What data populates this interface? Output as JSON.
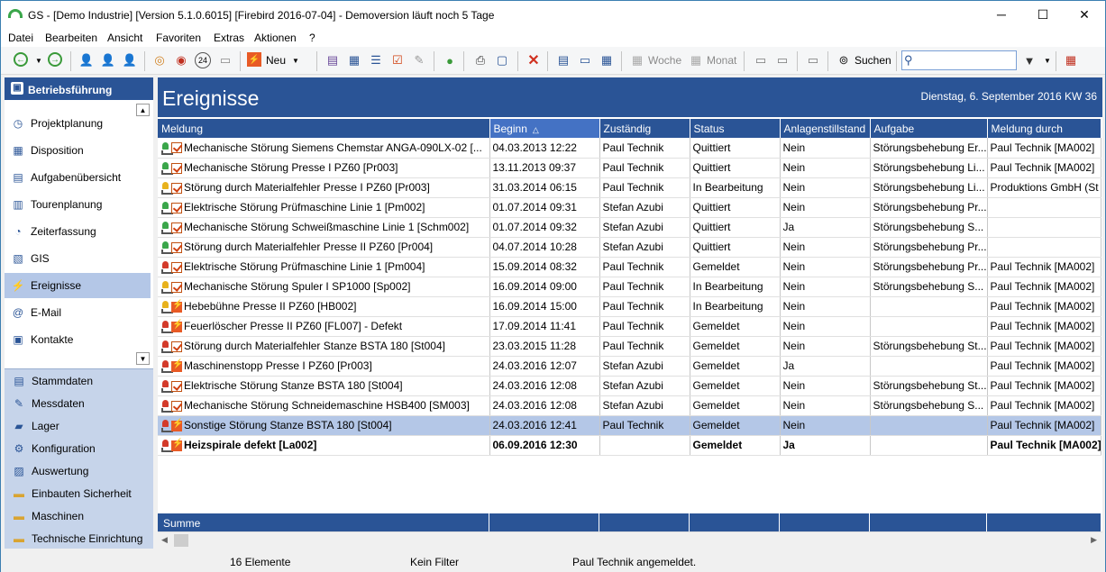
{
  "window": {
    "title": "GS - [Demo Industrie]  [Version  5.1.0.6015]  [Firebird 2016-07-04] - Demoversion läuft noch 5 Tage",
    "min": "─",
    "max": "☐",
    "close": "✕"
  },
  "menu": [
    "Datei",
    "Bearbeiten",
    "Ansicht",
    "Favoriten",
    "Extras",
    "Aktionen",
    "?"
  ],
  "toolbar": {
    "neu": "Neu",
    "woche": "Woche",
    "monat": "Monat",
    "suchen": "Suchen",
    "search_value": ""
  },
  "sidebar": {
    "header": "Betriebsführung",
    "items": [
      {
        "label": "Projektplanung",
        "icon": "project-icon",
        "glyph": "◷"
      },
      {
        "label": "Disposition",
        "icon": "calendar-icon",
        "glyph": "▦"
      },
      {
        "label": "Aufgabenübersicht",
        "icon": "tasks-icon",
        "glyph": "▤"
      },
      {
        "label": "Tourenplanung",
        "icon": "route-icon",
        "glyph": "▥"
      },
      {
        "label": "Zeiterfassung",
        "icon": "clock-icon",
        "glyph": "◔"
      },
      {
        "label": "GIS",
        "icon": "map-icon",
        "glyph": "▧"
      },
      {
        "label": "Ereignisse",
        "icon": "event-icon",
        "glyph": "⚡"
      },
      {
        "label": "E-Mail",
        "icon": "email-icon",
        "glyph": "@"
      },
      {
        "label": "Kontakte",
        "icon": "contacts-icon",
        "glyph": "▣"
      }
    ],
    "bottom": [
      {
        "label": "Stammdaten",
        "icon": "database-icon",
        "glyph": "▤"
      },
      {
        "label": "Messdaten",
        "icon": "gauge-icon",
        "glyph": "✎"
      },
      {
        "label": "Lager",
        "icon": "warehouse-icon",
        "glyph": "▰"
      },
      {
        "label": "Konfiguration",
        "icon": "gear-icon",
        "glyph": "⚙"
      },
      {
        "label": "Auswertung",
        "icon": "report-icon",
        "glyph": "▨"
      },
      {
        "label": "Einbauten Sicherheit",
        "icon": "folder-icon",
        "glyph": "▬"
      },
      {
        "label": "Maschinen",
        "icon": "folder-icon",
        "glyph": "▬"
      },
      {
        "label": "Technische Einrichtung",
        "icon": "folder-icon",
        "glyph": "▬"
      }
    ]
  },
  "main": {
    "title": "Ereignisse",
    "date": "Dienstag, 6. September 2016  KW 36"
  },
  "table": {
    "columns": [
      "Meldung",
      "Beginn",
      "Zuständig",
      "Status",
      "Anlagenstillstand",
      "Aufgabe",
      "Meldung durch"
    ],
    "sort_indicator": "△",
    "rows": [
      {
        "lamp": "green",
        "icon": "check",
        "meldung": "Mechanische Störung Siemens Chemstar ANGA-090LX-02 [...",
        "beginn": "04.03.2013 12:22",
        "zust": "Paul Technik",
        "status": "Quittiert",
        "still": "Nein",
        "aufgabe": "Störungsbehebung Er...",
        "durch": "Paul Technik [MA002]"
      },
      {
        "lamp": "green",
        "icon": "check",
        "meldung": "Mechanische Störung Presse I PZ60 [Pr003]",
        "beginn": "13.11.2013 09:37",
        "zust": "Paul Technik",
        "status": "Quittiert",
        "still": "Nein",
        "aufgabe": "Störungsbehebung Li...",
        "durch": "Paul Technik [MA002]"
      },
      {
        "lamp": "yellow",
        "icon": "check",
        "meldung": "Störung durch Materialfehler Presse I PZ60 [Pr003]",
        "beginn": "31.03.2014 06:15",
        "zust": "Paul Technik",
        "status": "In Bearbeitung",
        "still": "Nein",
        "aufgabe": "Störungsbehebung Li...",
        "durch": "Produktions GmbH  (St"
      },
      {
        "lamp": "green",
        "icon": "check",
        "meldung": "Elektrische Störung Prüfmaschine Linie 1 [Pm002]",
        "beginn": "01.07.2014 09:31",
        "zust": "Stefan Azubi",
        "status": "Quittiert",
        "still": "Nein",
        "aufgabe": "Störungsbehebung Pr...",
        "durch": ""
      },
      {
        "lamp": "green",
        "icon": "check",
        "meldung": "Mechanische Störung Schweißmaschine Linie 1 [Schm002]",
        "beginn": "01.07.2014 09:32",
        "zust": "Stefan Azubi",
        "status": "Quittiert",
        "still": "Ja",
        "aufgabe": "Störungsbehebung S...",
        "durch": ""
      },
      {
        "lamp": "green",
        "icon": "check",
        "meldung": "Störung durch Materialfehler Presse II PZ60 [Pr004]",
        "beginn": "04.07.2014 10:28",
        "zust": "Stefan Azubi",
        "status": "Quittiert",
        "still": "Nein",
        "aufgabe": "Störungsbehebung Pr...",
        "durch": ""
      },
      {
        "lamp": "red",
        "icon": "check",
        "meldung": "Elektrische Störung Prüfmaschine Linie 1 [Pm004]",
        "beginn": "15.09.2014 08:32",
        "zust": "Paul Technik",
        "status": "Gemeldet",
        "still": "Nein",
        "aufgabe": "Störungsbehebung Pr...",
        "durch": "Paul Technik [MA002]"
      },
      {
        "lamp": "yellow",
        "icon": "check",
        "meldung": "Mechanische Störung Spuler I SP1000 [Sp002]",
        "beginn": "16.09.2014 09:00",
        "zust": "Paul Technik",
        "status": "In Bearbeitung",
        "still": "Nein",
        "aufgabe": "Störungsbehebung S...",
        "durch": "Paul Technik [MA002]"
      },
      {
        "lamp": "yellow",
        "icon": "flash",
        "meldung": "Hebebühne Presse II PZ60 [HB002]",
        "beginn": "16.09.2014 15:00",
        "zust": "Paul Technik",
        "status": "In Bearbeitung",
        "still": "Nein",
        "aufgabe": "",
        "durch": "Paul Technik [MA002]"
      },
      {
        "lamp": "red",
        "icon": "flash",
        "meldung": "Feuerlöscher Presse  II PZ60 [FL007] - Defekt",
        "beginn": "17.09.2014 11:41",
        "zust": "Paul Technik",
        "status": "Gemeldet",
        "still": "Nein",
        "aufgabe": "",
        "durch": "Paul Technik [MA002]"
      },
      {
        "lamp": "red",
        "icon": "check",
        "meldung": "Störung durch Materialfehler Stanze BSTA 180 [St004]",
        "beginn": "23.03.2015 11:28",
        "zust": "Paul Technik",
        "status": "Gemeldet",
        "still": "Nein",
        "aufgabe": "Störungsbehebung St...",
        "durch": "Paul Technik [MA002]"
      },
      {
        "lamp": "red",
        "icon": "flash",
        "meldung": "Maschinenstopp Presse I PZ60 [Pr003]",
        "beginn": "24.03.2016 12:07",
        "zust": "Stefan Azubi",
        "status": "Gemeldet",
        "still": "Ja",
        "aufgabe": "",
        "durch": "Paul Technik [MA002]"
      },
      {
        "lamp": "red",
        "icon": "check",
        "meldung": "Elektrische Störung Stanze BSTA 180 [St004]",
        "beginn": "24.03.2016 12:08",
        "zust": "Stefan Azubi",
        "status": "Gemeldet",
        "still": "Nein",
        "aufgabe": "Störungsbehebung St...",
        "durch": "Paul Technik [MA002]"
      },
      {
        "lamp": "red",
        "icon": "check",
        "meldung": "Mechanische Störung Schneidemaschine HSB400 [SM003]",
        "beginn": "24.03.2016 12:08",
        "zust": "Stefan Azubi",
        "status": "Gemeldet",
        "still": "Nein",
        "aufgabe": "Störungsbehebung S...",
        "durch": "Paul Technik [MA002]"
      },
      {
        "lamp": "red",
        "icon": "flash",
        "meldung": "Sonstige Störung Stanze BSTA 180 [St004]",
        "beginn": "24.03.2016 12:41",
        "zust": "Paul Technik",
        "status": "Gemeldet",
        "still": "Nein",
        "aufgabe": "",
        "durch": "Paul Technik [MA002]"
      },
      {
        "lamp": "red",
        "icon": "flash",
        "meldung": "Heizspirale defekt [La002]",
        "beginn": "06.09.2016 12:30",
        "zust": "",
        "status": "Gemeldet",
        "still": "Ja",
        "aufgabe": "",
        "durch": "Paul Technik [MA002]"
      }
    ],
    "summe": "Summe"
  },
  "status": {
    "count": "16 Elemente",
    "filter": "Kein Filter",
    "user": "Paul Technik angemeldet."
  },
  "colors": {
    "accent": "#2a5496",
    "selection": "#b4c7e7",
    "lamp_green": "#3aa64a",
    "lamp_yellow": "#e8b21c",
    "lamp_red": "#d33a2a"
  }
}
